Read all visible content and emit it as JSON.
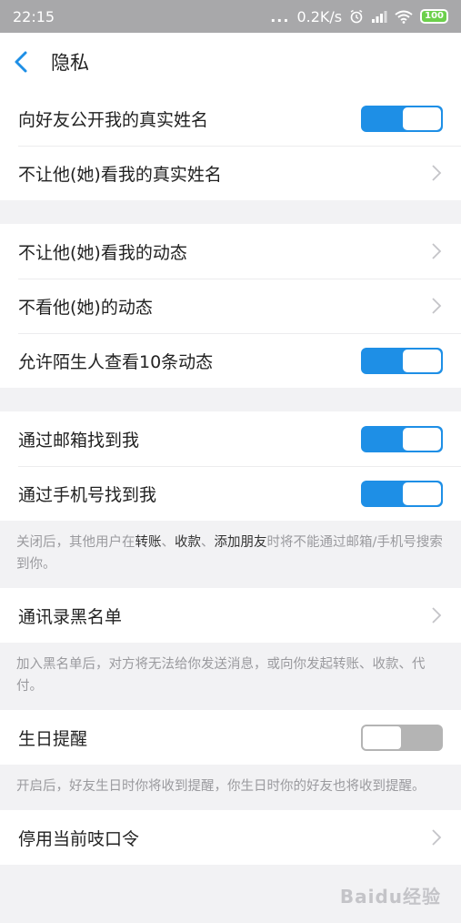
{
  "status_bar": {
    "time": "22:15",
    "dots": "...",
    "speed": "0.2K/s",
    "battery": "100",
    "icons": [
      "alarm-icon",
      "signal-icon",
      "wifi-icon",
      "battery-icon"
    ]
  },
  "header": {
    "title": "隐私",
    "accent_color": "#1e8fe6"
  },
  "groups": [
    {
      "rows": [
        {
          "label": "向好友公开我的真实姓名",
          "control": "toggle",
          "on": true
        },
        {
          "label": "不让他(她)看我的真实姓名",
          "control": "chevron"
        }
      ]
    },
    {
      "rows": [
        {
          "label": "不让他(她)看我的动态",
          "control": "chevron"
        },
        {
          "label": "不看他(她)的动态",
          "control": "chevron"
        },
        {
          "label": "允许陌生人查看10条动态",
          "control": "toggle",
          "on": true
        }
      ]
    },
    {
      "rows": [
        {
          "label": "通过邮箱找到我",
          "control": "toggle",
          "on": true
        },
        {
          "label": "通过手机号找到我",
          "control": "toggle",
          "on": true
        }
      ]
    }
  ],
  "notes": {
    "find_me": {
      "prefix": "关闭后，其他用户在",
      "k1": "转账",
      "sep1": "、",
      "k2": "收款",
      "sep2": "、",
      "k3": "添加朋友",
      "suffix": "时将不能通过邮箱/手机号搜索到你。"
    },
    "blacklist": "加入黑名单后，对方将无法给你发送消息，或向你发起转账、收款、代付。",
    "birthday": "开启后，好友生日时你将收到提醒，你生日时你的好友也将收到提醒。"
  },
  "blacklist_row": {
    "label": "通讯录黑名单"
  },
  "birthday_row": {
    "label": "生日提醒",
    "on": false
  },
  "password_row": {
    "label": "停用当前吱口令"
  },
  "watermark": "Baidu经验"
}
